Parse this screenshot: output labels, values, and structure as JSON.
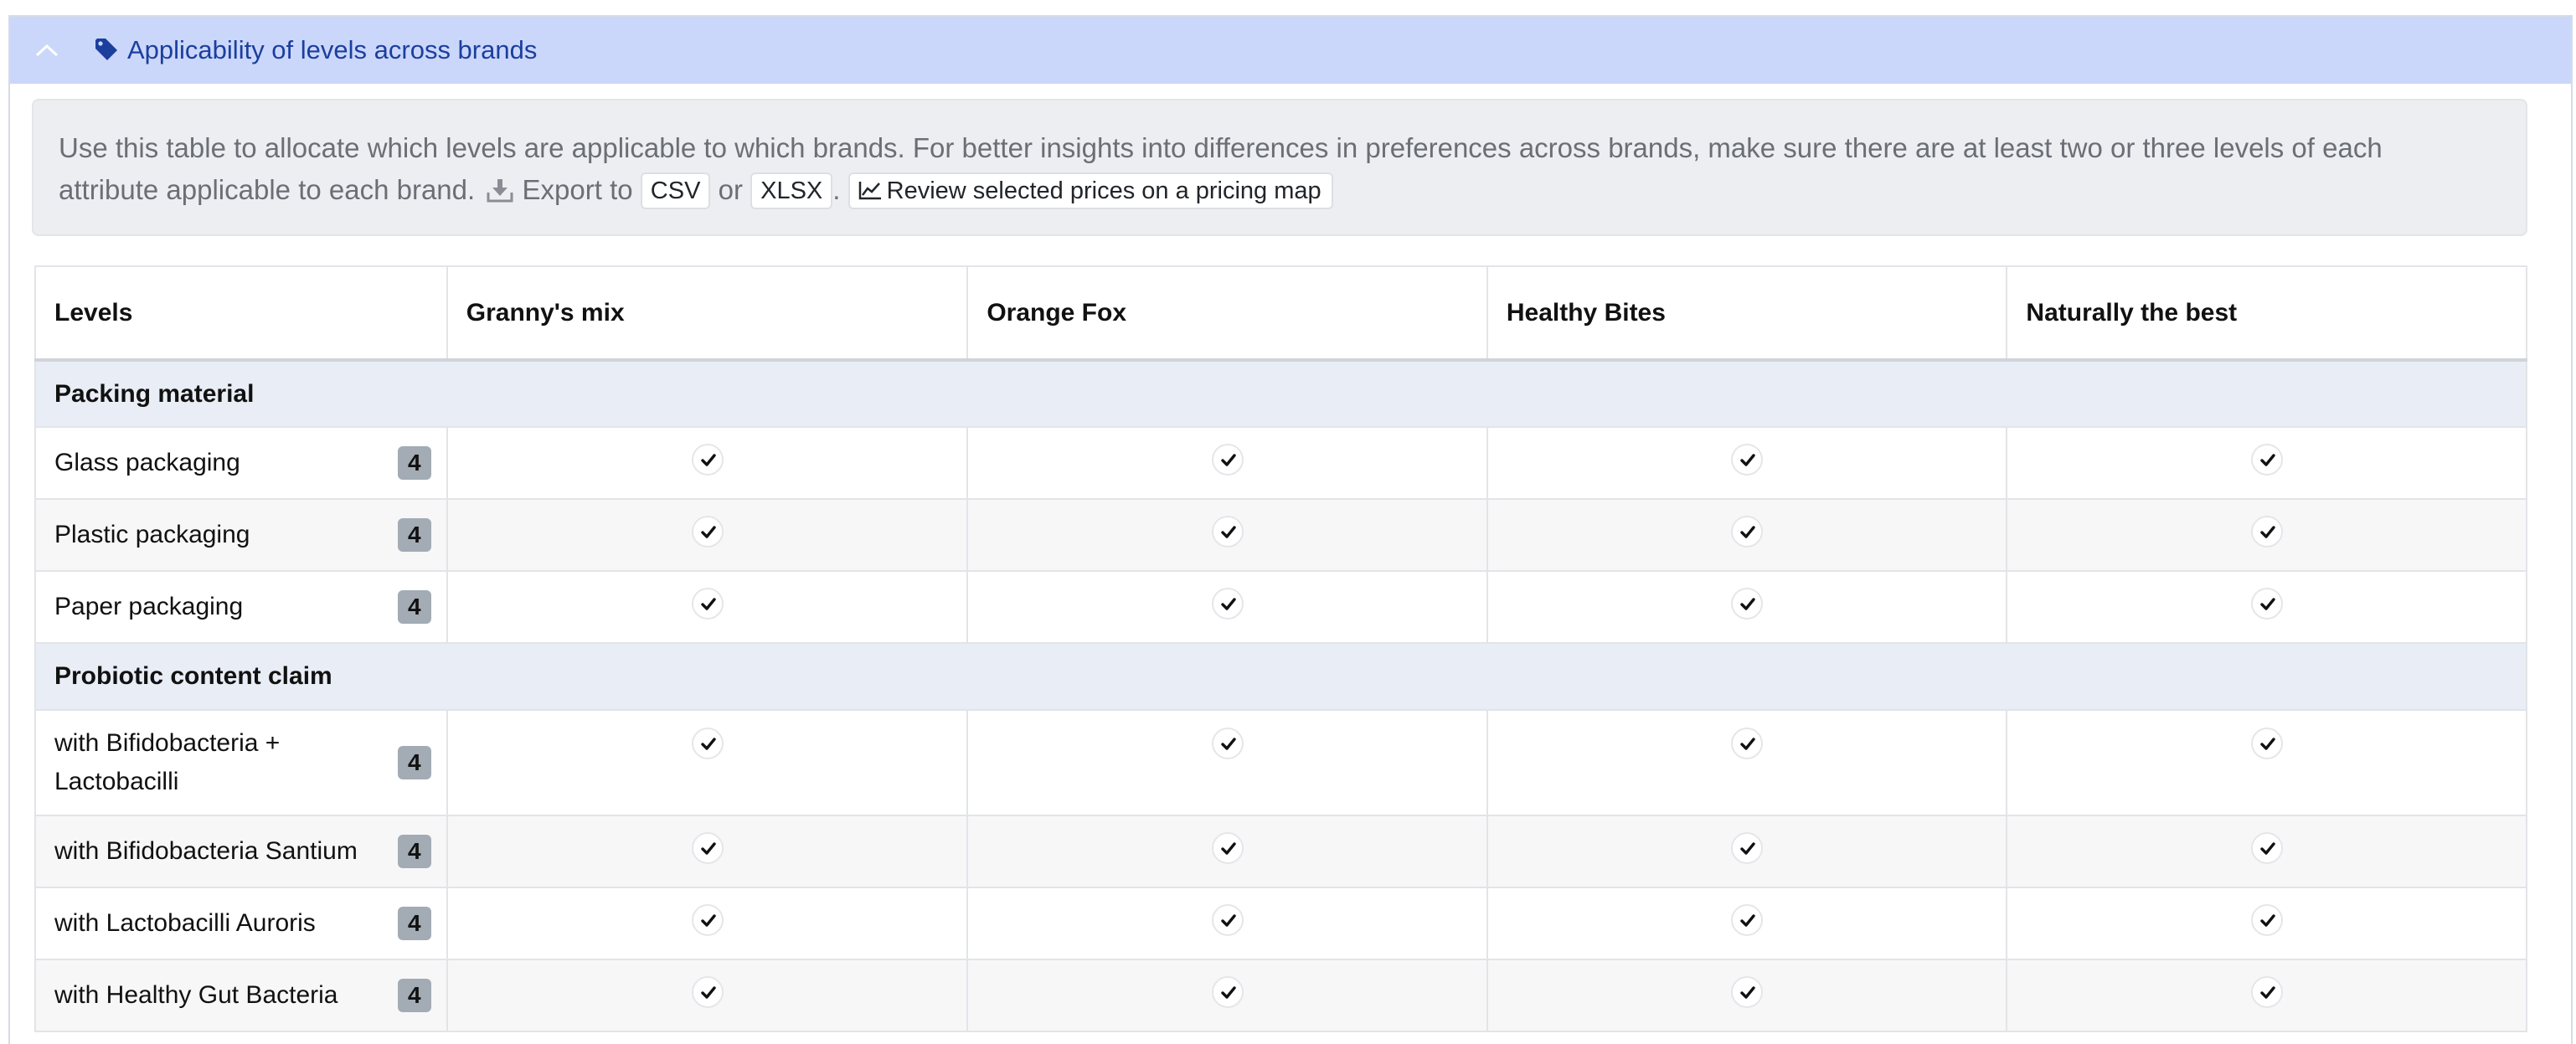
{
  "panel": {
    "title": "Applicability of levels across brands",
    "icons": {
      "collapse": "chevron-up-icon",
      "tag": "tag-icon"
    }
  },
  "info": {
    "line1": "Use this table to allocate which levels are applicable to which brands. For better insights into differences in preferences across brands, make sure there are at least two or three levels of each",
    "line2_prefix": "attribute applicable to each brand.",
    "export_label": "Export to",
    "csv_label": "CSV",
    "or_label": "or",
    "xlsx_label": "XLSX",
    "period": ".",
    "pricing_map_label": "Review selected prices on a pricing map",
    "icons": {
      "export": "download-icon",
      "pricing_map": "line-chart-icon"
    }
  },
  "table": {
    "headers": [
      "Levels",
      "Granny's mix",
      "Orange Fox",
      "Healthy Bites",
      "Naturally the best"
    ],
    "groups": [
      {
        "name": "Packing material",
        "levels": [
          {
            "label": "Glass packaging",
            "count": "4",
            "checked": [
              true,
              true,
              true,
              true
            ]
          },
          {
            "label": "Plastic packaging",
            "count": "4",
            "checked": [
              true,
              true,
              true,
              true
            ]
          },
          {
            "label": "Paper packaging",
            "count": "4",
            "checked": [
              true,
              true,
              true,
              true
            ]
          }
        ]
      },
      {
        "name": "Probiotic content claim",
        "levels": [
          {
            "label": "with Bifidobacteria + Lactobacilli",
            "count": "4",
            "checked": [
              true,
              true,
              true,
              true
            ]
          },
          {
            "label": "with Bifidobacteria Santium",
            "count": "4",
            "checked": [
              true,
              true,
              true,
              true
            ]
          },
          {
            "label": "with Lactobacilli Auroris",
            "count": "4",
            "checked": [
              true,
              true,
              true,
              true
            ]
          },
          {
            "label": "with Healthy Gut Bacteria",
            "count": "4",
            "checked": [
              true,
              true,
              true,
              true
            ]
          }
        ]
      }
    ]
  }
}
